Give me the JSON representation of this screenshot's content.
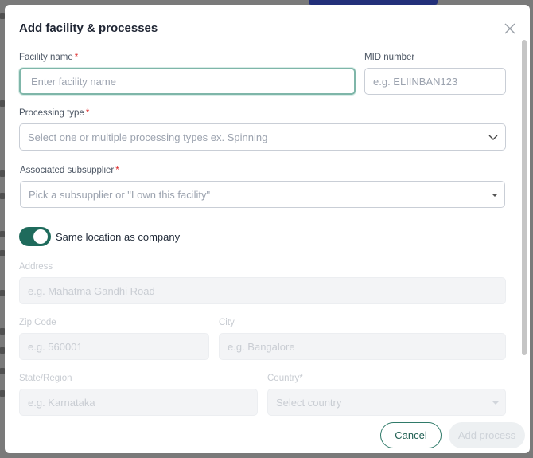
{
  "modal": {
    "title": "Add facility & processes",
    "close_icon": "close-icon"
  },
  "form": {
    "facility_name": {
      "label": "Facility name",
      "required_mark": "*",
      "placeholder": "Enter facility name",
      "value": ""
    },
    "mid_number": {
      "label": "MID number",
      "placeholder": "e.g. ELIINBAN123",
      "value": ""
    },
    "processing_type": {
      "label": "Processing type",
      "required_mark": "*",
      "placeholder": "Select one or multiple processing types ex. Spinning",
      "icon": "chevron-down-icon"
    },
    "associated_subsupplier": {
      "label": "Associated subsupplier",
      "required_mark": "*",
      "placeholder": "Pick a subsupplier or \"I own this facility\"",
      "icon": "caret-down-icon"
    },
    "same_location": {
      "label": "Same location as company",
      "checked": true
    },
    "address": {
      "label": "Address",
      "placeholder": "e.g. Mahatma Gandhi Road"
    },
    "zip_code": {
      "label": "Zip Code",
      "placeholder": "e.g. 560001"
    },
    "city": {
      "label": "City",
      "placeholder": "e.g. Bangalore"
    },
    "state_region": {
      "label": "State/Region",
      "placeholder": "e.g. Karnataka"
    },
    "country": {
      "label": "Country",
      "required_mark": "*",
      "placeholder": "Select country",
      "icon": "caret-down-icon"
    }
  },
  "footer": {
    "cancel_label": "Cancel",
    "add_label": "Add process"
  },
  "colors": {
    "accent": "#1f6b5c",
    "focus_border": "#7fb6a9",
    "required": "#dc2626",
    "disabled_bg": "#f3f4f6"
  }
}
